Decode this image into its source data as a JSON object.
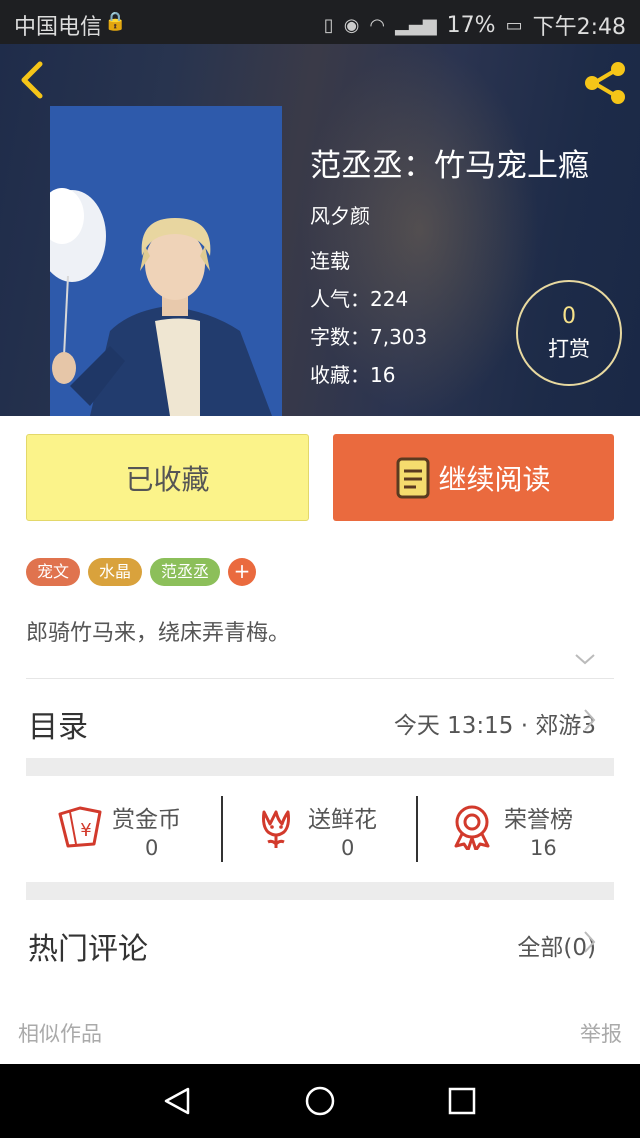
{
  "status_bar": {
    "carrier": "中国电信",
    "battery": "17%",
    "time": "下午2:48"
  },
  "book": {
    "title": "范丞丞：竹马宠上瘾",
    "author": "风夕颜",
    "status": "连载",
    "popularity": "人气：224",
    "word_count": "字数：7,303",
    "favorites": "收藏：16",
    "tip_count": "0",
    "tip_label": "打赏"
  },
  "actions": {
    "favorited_label": "已收藏",
    "continue_label": "继续阅读"
  },
  "tags": [
    {
      "label": "宠文",
      "color": "#e0734e"
    },
    {
      "label": "水晶",
      "color": "#d9a23c"
    },
    {
      "label": "范丞丞",
      "color": "#8cbf5a"
    }
  ],
  "tag_add": "+",
  "description": "郎骑竹马来，绕床弄青梅。",
  "toc": {
    "label": "目录",
    "latest": "今天 13:15 · 郊游3"
  },
  "stats": {
    "coins": {
      "label": "赏金币",
      "value": "0"
    },
    "flowers": {
      "label": "送鲜花",
      "value": "0"
    },
    "honor": {
      "label": "荣誉榜",
      "value": "16"
    }
  },
  "comments": {
    "label": "热门评论",
    "all": "全部(0)"
  },
  "footer": {
    "similar": "相似作品",
    "report": "举报"
  },
  "colors": {
    "accent_orange": "#ea6a3e",
    "favorite_yellow": "#fbf38a",
    "icon_red": "#d23a2c"
  }
}
